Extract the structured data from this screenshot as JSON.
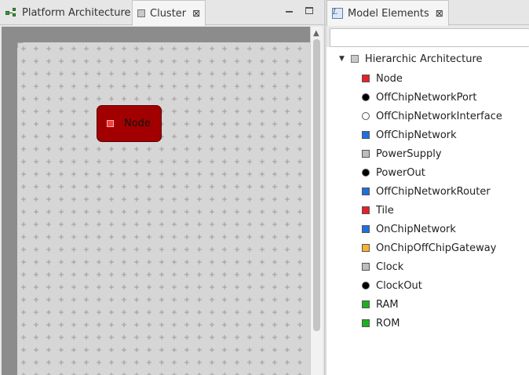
{
  "left_tabs": [
    {
      "label": "Platform Architecture",
      "icon": "platform-architecture-icon",
      "active": false
    },
    {
      "label": "Cluster",
      "icon": "diagram-icon",
      "active": true,
      "closable": true
    }
  ],
  "close_glyph": "⊠",
  "view_buttons": {
    "minimize": "minimize-icon",
    "maximize": "maximize-icon"
  },
  "diagram": {
    "node": {
      "label": "Node",
      "color": "#a20000",
      "marker_color": "#ff3b3b"
    }
  },
  "right_tab": {
    "label": "Model Elements",
    "icon": "model-elements-icon",
    "closable": true
  },
  "model_elements": {
    "filter_value": "",
    "root": {
      "label": "Hierarchic Architecture",
      "expanded": true,
      "marker": "square",
      "color": "#c9c9c9"
    },
    "items": [
      {
        "label": "Node",
        "marker": "square",
        "color": "#e8202a"
      },
      {
        "label": "OffChipNetworkPort",
        "marker": "circle",
        "color": "#000000"
      },
      {
        "label": "OffChipNetworkInterface",
        "marker": "circle",
        "color": "#ffffff"
      },
      {
        "label": "OffChipNetwork",
        "marker": "square",
        "color": "#1e6fe0"
      },
      {
        "label": "PowerSupply",
        "marker": "square",
        "color": "#bdbdbd"
      },
      {
        "label": "PowerOut",
        "marker": "circle",
        "color": "#000000"
      },
      {
        "label": "OffChipNetworkRouter",
        "marker": "square",
        "color": "#1e6fe0"
      },
      {
        "label": "Tile",
        "marker": "square",
        "color": "#e8202a"
      },
      {
        "label": "OnChipNetwork",
        "marker": "square",
        "color": "#1e6fe0"
      },
      {
        "label": "OnChipOffChipGateway",
        "marker": "square",
        "color": "#ffb030"
      },
      {
        "label": "Clock",
        "marker": "square",
        "color": "#bdbdbd"
      },
      {
        "label": "ClockOut",
        "marker": "circle",
        "color": "#000000"
      },
      {
        "label": "RAM",
        "marker": "square",
        "color": "#1fb01f"
      },
      {
        "label": "ROM",
        "marker": "square",
        "color": "#1fb01f"
      }
    ]
  }
}
